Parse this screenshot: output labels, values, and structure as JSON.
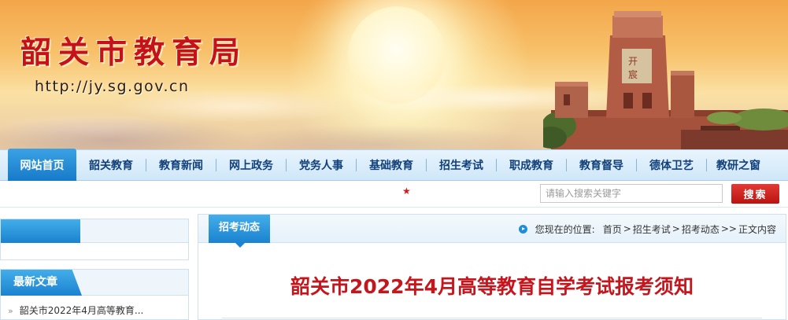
{
  "header": {
    "site_title": "韶关市教育局",
    "site_url": "http://jy.sg.gov.cn"
  },
  "nav": {
    "items": [
      {
        "label": "网站首页",
        "active": true
      },
      {
        "label": "韶关教育"
      },
      {
        "label": "教育新闻"
      },
      {
        "label": "网上政务"
      },
      {
        "label": "党务人事"
      },
      {
        "label": "基础教育"
      },
      {
        "label": "招生考试"
      },
      {
        "label": "职成教育"
      },
      {
        "label": "教育督导"
      },
      {
        "label": "德体卫艺"
      },
      {
        "label": "教研之窗"
      }
    ]
  },
  "search": {
    "placeholder": "请输入搜索关键字",
    "button_label": "搜索",
    "star_glyph": "★"
  },
  "sidebar": {
    "latest_heading": "最新文章",
    "latest_items": [
      {
        "label": "韶关市2022年4月高等教育..."
      }
    ]
  },
  "main": {
    "section_tab": "招考动态",
    "breadcrumb": {
      "prefix": "您现在的位置:",
      "items": [
        "首页",
        "招生考试",
        "招考动态",
        "正文内容"
      ],
      "separators": [
        ">",
        ">",
        ">>"
      ]
    },
    "article_title": "韶关市2022年4月高等教育自学考试报考须知"
  },
  "colors": {
    "accent_blue": "#1a82cf",
    "title_red": "#c4161c",
    "search_red": "#cc1f1b"
  }
}
